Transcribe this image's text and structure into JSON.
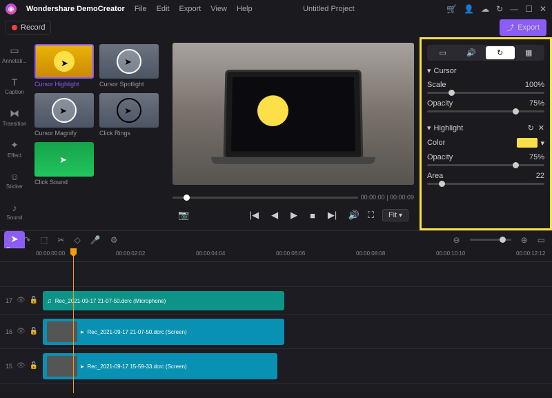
{
  "app_name": "Wondershare DemoCreator",
  "menu": [
    "File",
    "Edit",
    "Export",
    "View",
    "Help"
  ],
  "project_title": "Untitled Project",
  "record_label": "Record",
  "export_label": "Export",
  "sidebar": [
    {
      "label": "Annotati..."
    },
    {
      "label": "Caption"
    },
    {
      "label": "Transition"
    },
    {
      "label": "Effect"
    },
    {
      "label": "Sticker"
    },
    {
      "label": "Sound"
    },
    {
      "label": "Cursor"
    }
  ],
  "effects": [
    {
      "label": "Cursor Highlight"
    },
    {
      "label": "Cursor Spotlight"
    },
    {
      "label": "Cursor Magnify"
    },
    {
      "label": "Click Rings"
    },
    {
      "label": "Click Sound"
    }
  ],
  "playback": {
    "time": "00:00:00 | 00:00:09",
    "fit": "Fit"
  },
  "props": {
    "cursor": {
      "title": "Cursor",
      "scale_label": "Scale",
      "scale_value": "100%",
      "opacity_label": "Opacity",
      "opacity_value": "75%"
    },
    "highlight": {
      "title": "Highlight",
      "color_label": "Color",
      "opacity_label": "Opacity",
      "opacity_value": "75%",
      "area_label": "Area",
      "area_value": "22"
    }
  },
  "timeline": {
    "ticks": [
      "00:00:00:00",
      "00:00:02:02",
      "00:00:04:04",
      "00:00:06:06",
      "00:00:08:08",
      "00:00:10:10",
      "00:00:12:12"
    ],
    "tracks": [
      {
        "num": "17",
        "clip": "Rec_2021-09-17 21-07-50.dcrc (Microphone)"
      },
      {
        "num": "16",
        "clip": "Rec_2021-09-17 21-07-50.dcrc (Screen)"
      },
      {
        "num": "15",
        "clip": "Rec_2021-09-17 15-59-33.dcrc (Screen)"
      }
    ]
  }
}
